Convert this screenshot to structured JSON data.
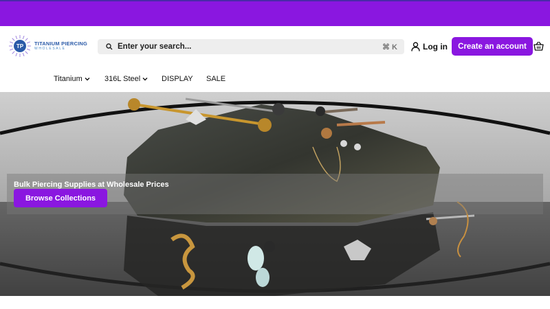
{
  "colors": {
    "brand": "#8a17e0",
    "logo": "#2a5aa8"
  },
  "logo": {
    "title": "TITANIUM PIERCING",
    "subtitle": "WHOLESALE",
    "mark_text": "TP"
  },
  "search": {
    "placeholder": "Enter your search...",
    "shortcut": "⌘ K",
    "icon": "search-icon"
  },
  "account": {
    "login_label": "Log in",
    "login_icon": "user-icon",
    "create_label": "Create an account",
    "cart_icon": "basket-icon"
  },
  "nav": {
    "items": [
      {
        "label": "Titanium",
        "has_dropdown": true
      },
      {
        "label": "316L Steel",
        "has_dropdown": true
      },
      {
        "label": "DISPLAY",
        "has_dropdown": false
      },
      {
        "label": "SALE",
        "has_dropdown": false
      }
    ]
  },
  "hero": {
    "title": "Bulk Piercing Supplies at Wholesale Prices",
    "cta_label": "Browse Collections"
  }
}
